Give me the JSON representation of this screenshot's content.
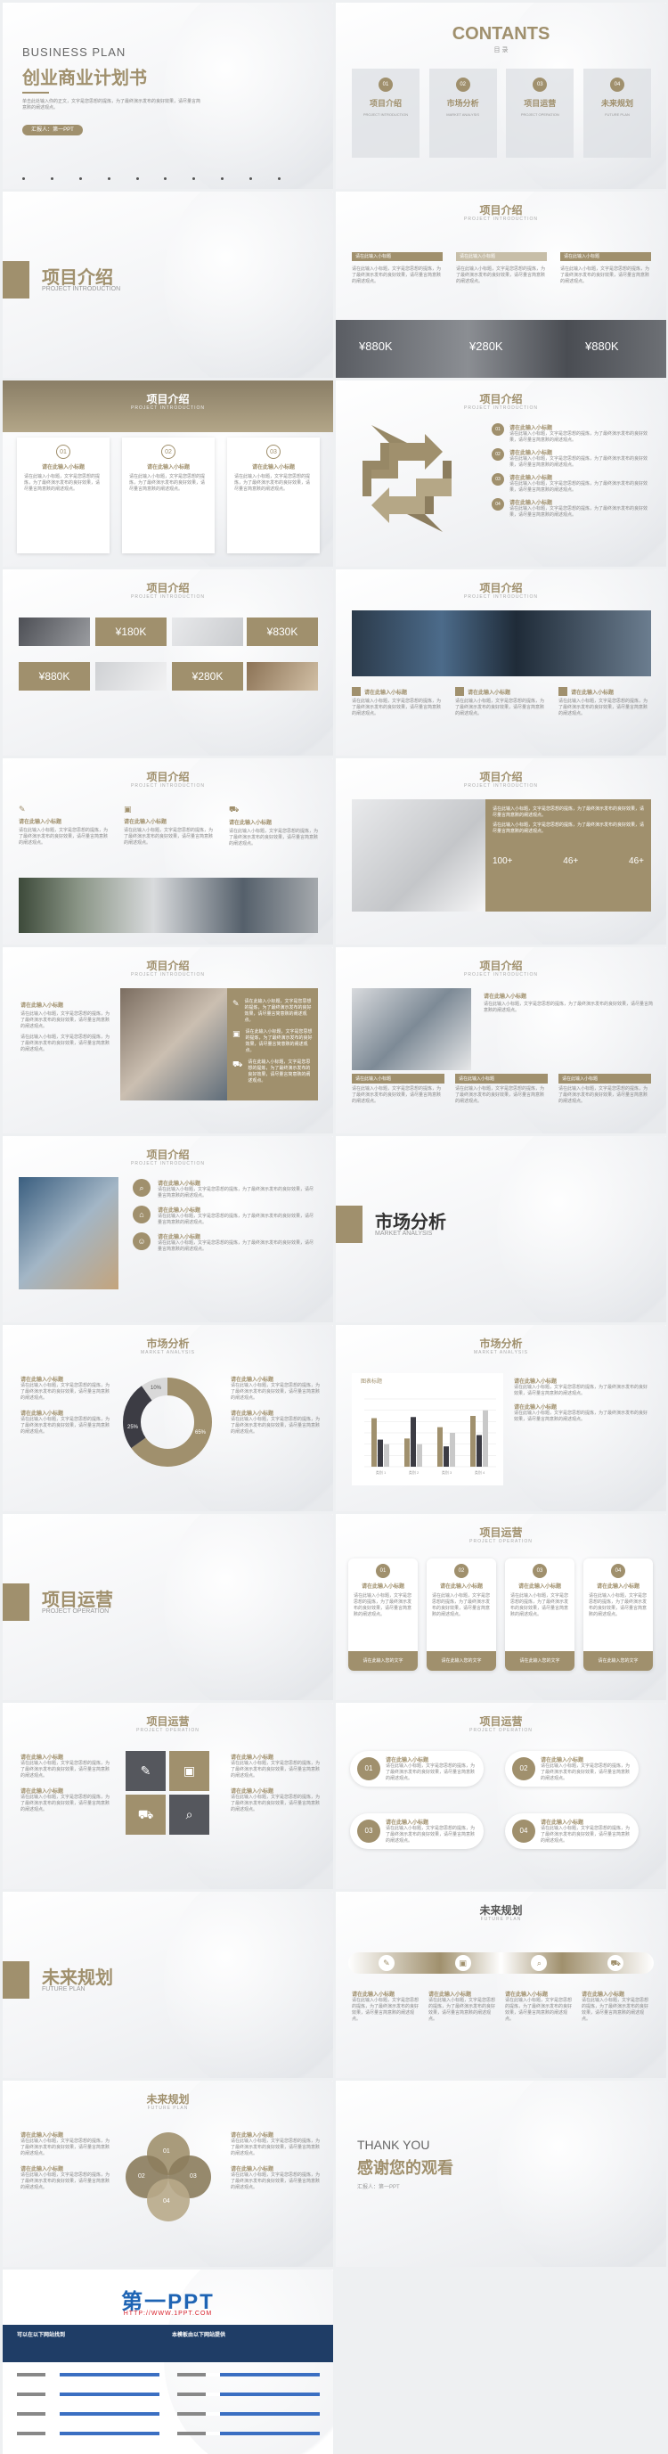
{
  "cover": {
    "en_title": "BUSINESS PLAN",
    "cn_title": "创业商业计划书",
    "desc": "单击此处输入你的正文，文字是您思想的提炼，为了最终演示发布的良好效果，请尽量言简意赅的阐述观点。",
    "presenter": "汇报人：第一PPT"
  },
  "contents": {
    "title": "CONTANTS",
    "subtitle": "目 录",
    "items": [
      {
        "num": "01",
        "label": "项目介绍",
        "en": "PROJECT INTRODUCTION"
      },
      {
        "num": "02",
        "label": "市场分析",
        "en": "MARKET ANALYSIS"
      },
      {
        "num": "03",
        "label": "项目运营",
        "en": "PROJECT OPERATION"
      },
      {
        "num": "04",
        "label": "未来规划",
        "en": "FUTURE PLAN"
      }
    ]
  },
  "sections": {
    "s1": {
      "title": "项目介绍",
      "en": "PROJECT INTRODUCTION"
    },
    "s2": {
      "title": "市场分析",
      "en": "MARKET ANALYSIS"
    },
    "s3": {
      "title": "项目运营",
      "en": "PROJECT OPERATION"
    },
    "s4": {
      "title": "未来规划",
      "en": "FUTURE PLAN"
    }
  },
  "common": {
    "slide_en": "PROJECT INTRODUCTION",
    "market_en": "MARKET ANALYSIS",
    "operation_en": "PROJECT OPERATION",
    "future_en": "FUTURE PLAN",
    "subhead": "请在此输入标题",
    "subhead2": "请在此输入小标题",
    "body": "请在此输入小标题，文字是您思想的提炼，为了最终演示发布的良好效果，请尽量言简意赅的阐述观点。",
    "short": "请在此输入您的文字"
  },
  "values": {
    "v1": "¥880K",
    "v2": "¥280K",
    "v3": "¥880K",
    "v4": "¥180K",
    "v5": "¥830K",
    "v6": "¥880K",
    "v7": "¥280K"
  },
  "stats": {
    "a": "100+",
    "b": "46+",
    "c": "46+"
  },
  "nums": {
    "n1": "01",
    "n2": "02",
    "n3": "03",
    "n4": "04"
  },
  "donut": {
    "p1": "10%",
    "p2": "25%",
    "p3": "65%"
  },
  "bar_title": "图表标题",
  "chart_data": {
    "type": "bar",
    "categories": [
      "类别 1",
      "类别 2",
      "类别 3",
      "类别 4"
    ],
    "series": [
      {
        "name": "",
        "values": [
          4.3,
          2.5,
          3.5,
          4.5
        ],
        "color": "#a0906d"
      },
      {
        "name": "",
        "values": [
          2.4,
          4.4,
          1.8,
          2.8
        ],
        "color": "#3c3c44"
      },
      {
        "name": "",
        "values": [
          2.0,
          2.0,
          3.0,
          5.0
        ],
        "color": "#c9c9c9"
      }
    ],
    "ylim": [
      0,
      6
    ]
  },
  "thanks": {
    "en": "THANK YOU",
    "cn": "感谢您的观看",
    "presenter": "汇报人：第一PPT"
  },
  "brand": {
    "logo": "第一PPT",
    "url": "HTTP://WWW.1PPT.COM",
    "left_heading": "可以在以下网站找到",
    "right_heading": "本模板由以下网站提供",
    "accent": "#a0906d"
  }
}
